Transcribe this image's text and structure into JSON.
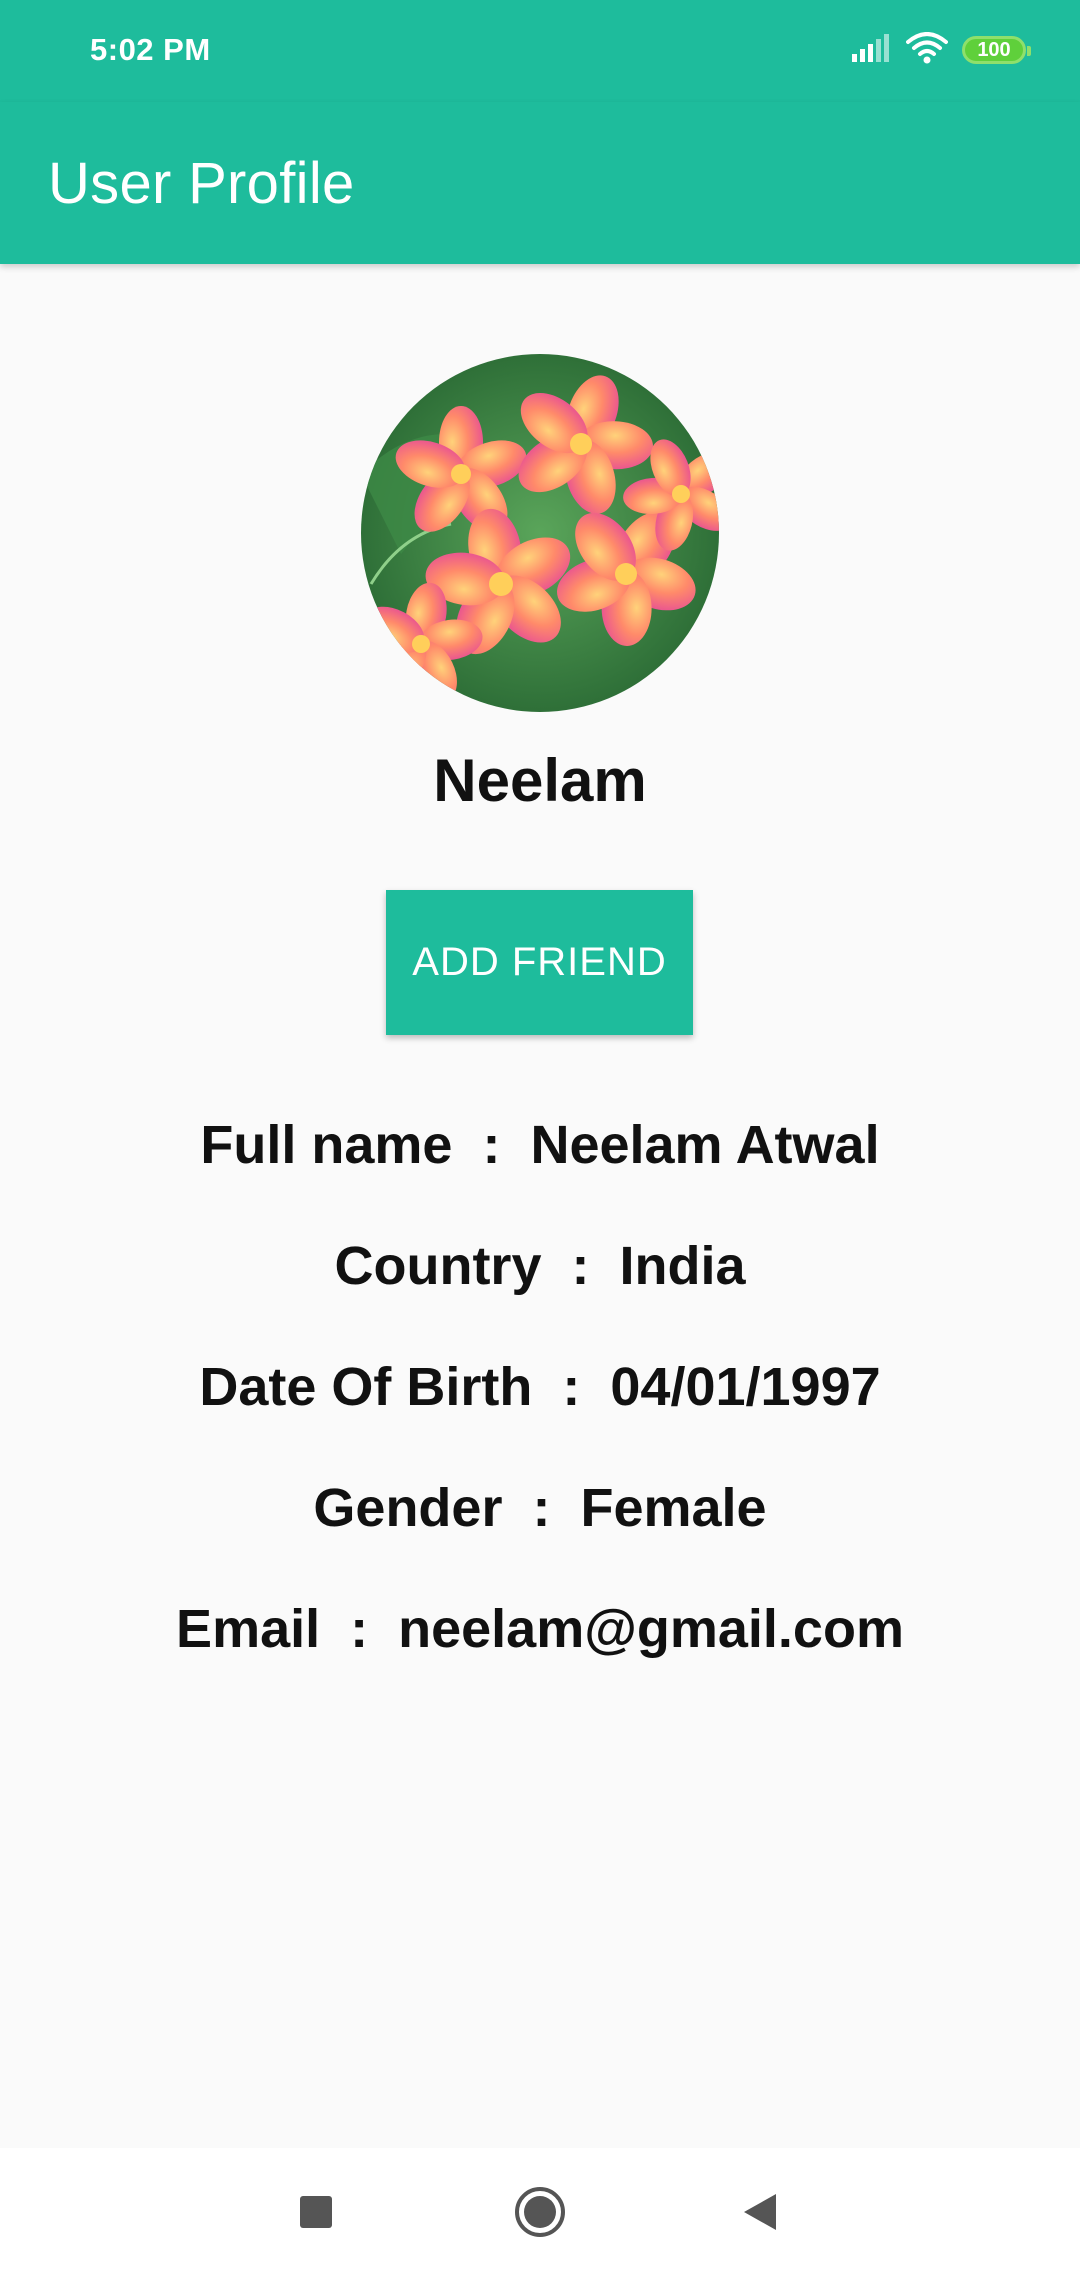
{
  "status_bar": {
    "time": "5:02 PM",
    "battery": "100",
    "icons": [
      "signal-icon",
      "wifi-icon",
      "battery-icon"
    ]
  },
  "toolbar": {
    "title": "User Profile"
  },
  "profile": {
    "avatar_icon": "flower-photo",
    "name": "Neelam",
    "add_friend_label": "ADD FRIEND"
  },
  "info": [
    {
      "label": "Full name",
      "value": "Neelam Atwal"
    },
    {
      "label": "Country",
      "value": "India"
    },
    {
      "label": "Date Of Birth",
      "value": "04/01/1997"
    },
    {
      "label": "Gender",
      "value": "Female"
    },
    {
      "label": "Email",
      "value": "neelam@gmail.com"
    }
  ],
  "navigation": {
    "icons": [
      "recents-icon",
      "home-icon",
      "back-icon"
    ]
  },
  "colors": {
    "primary": "#1ebc9c",
    "background": "#fafafa",
    "text": "#111111"
  }
}
